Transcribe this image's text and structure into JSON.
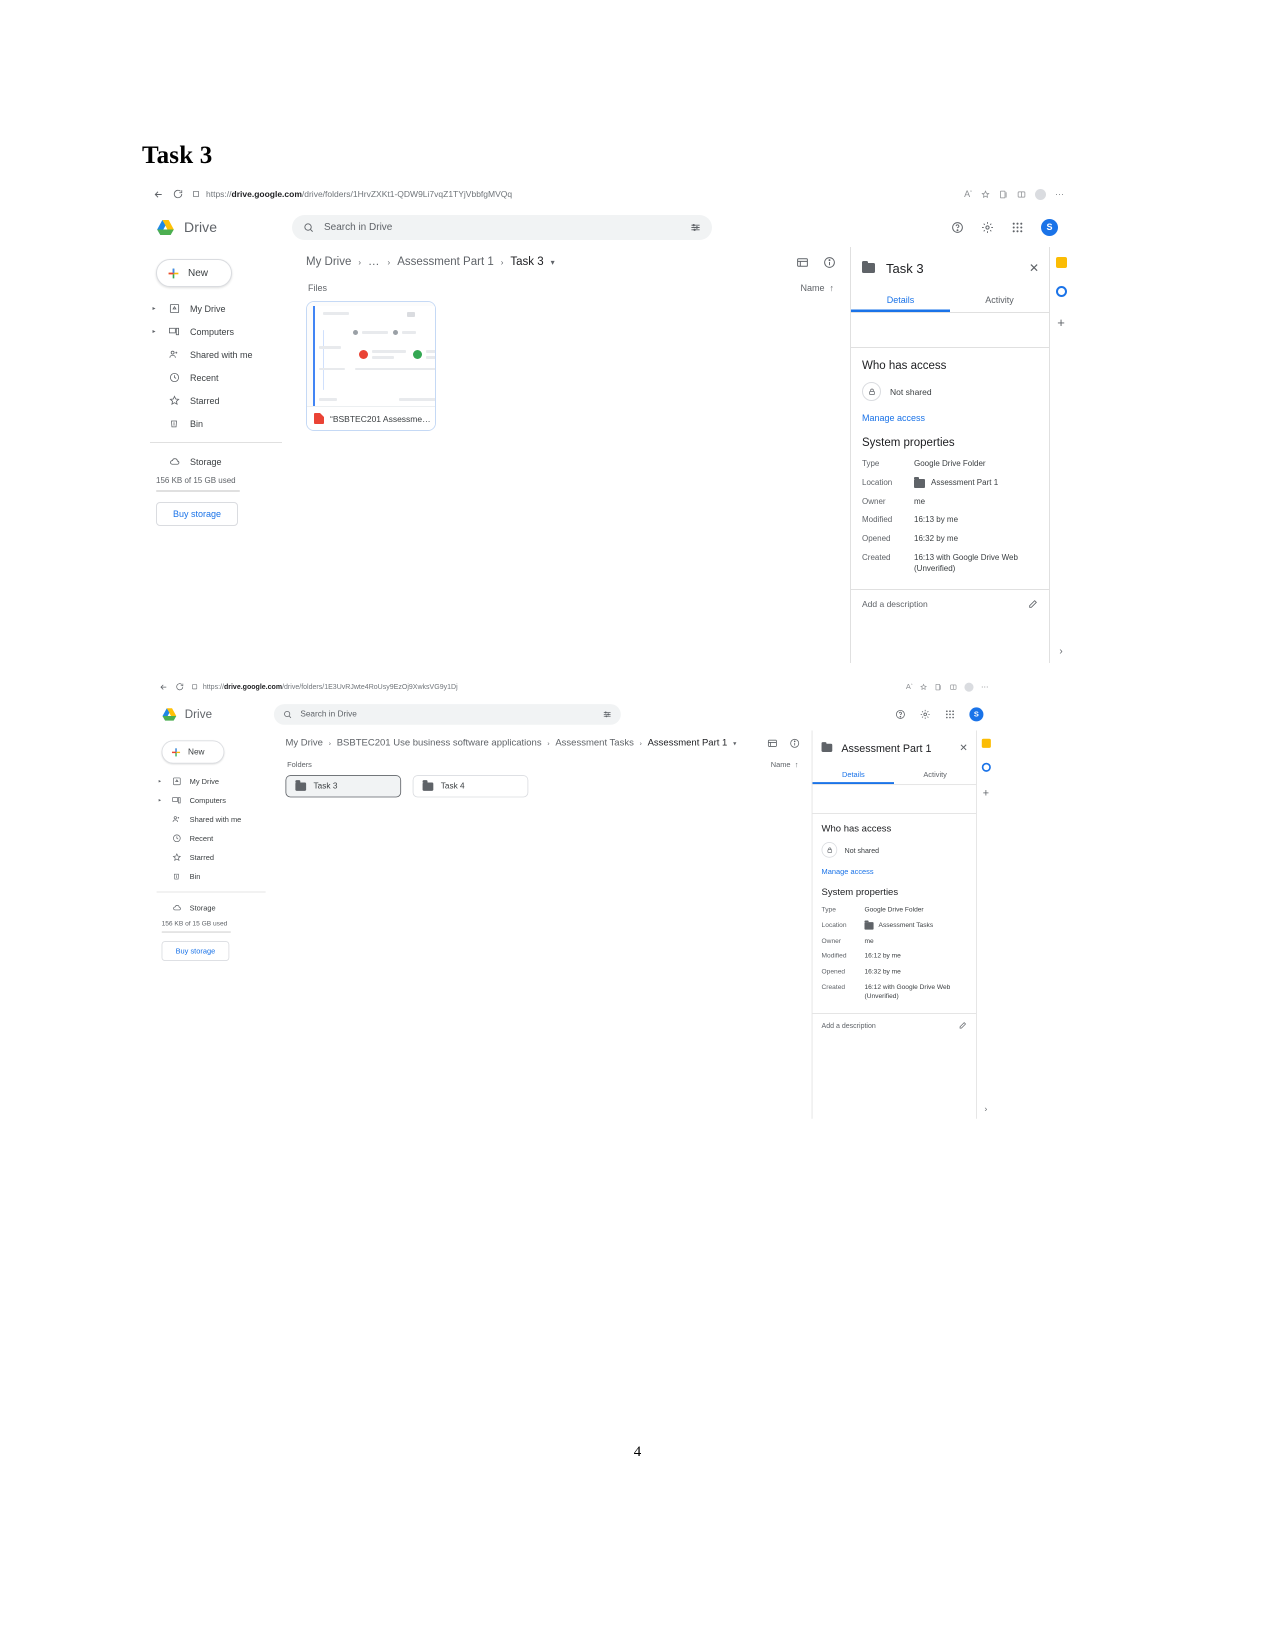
{
  "document": {
    "heading": "Task 3",
    "page_number": "4"
  },
  "screenshot1": {
    "browser": {
      "back_icon": "back-arrow-icon",
      "reload_icon": "reload-icon",
      "site_info_icon": "site-info-icon",
      "url_prefix": "https://",
      "url_domain": "drive.google.com",
      "url_path": "/drive/folders/1HrvZXKt1-QDW9Li7vqZ1TYjVbbfgMVQq",
      "toolbar_icons": [
        "read-aloud-icon",
        "favorites-icon",
        "collections-icon",
        "browser-essentials-icon",
        "profile-icon",
        "settings-more-icon"
      ]
    },
    "header": {
      "app_name": "Drive",
      "search_placeholder": "Search in Drive",
      "search_icon": "search-icon",
      "filter_icon": "search-options-icon",
      "help_icon": "help-icon",
      "settings_icon": "gear-icon",
      "apps_icon": "apps-grid-icon",
      "avatar_initial": "S"
    },
    "sidebar": {
      "new_button": "New",
      "items": [
        {
          "label": "My Drive",
          "icon": "my-drive-icon",
          "expandable": true
        },
        {
          "label": "Computers",
          "icon": "computers-icon",
          "expandable": true
        },
        {
          "label": "Shared with me",
          "icon": "shared-with-me-icon",
          "expandable": false
        },
        {
          "label": "Recent",
          "icon": "clock-icon",
          "expandable": false
        },
        {
          "label": "Starred",
          "icon": "star-icon",
          "expandable": false
        },
        {
          "label": "Bin",
          "icon": "trash-icon",
          "expandable": false
        }
      ],
      "storage_label": "Storage",
      "storage_icon": "cloud-icon",
      "storage_usage": "156 KB of 15 GB used",
      "buy_storage": "Buy storage"
    },
    "breadcrumb": {
      "items": [
        "My Drive",
        "…",
        "Assessment Part 1",
        "Task 3"
      ],
      "chevron": "›",
      "dropdown_icon": "chevron-down-icon",
      "list_view_icon": "list-view-icon",
      "info_icon": "info-icon"
    },
    "content": {
      "section_label": "Files",
      "sort_label": "Name",
      "sort_arrow": "↑",
      "files": [
        {
          "name": "“BSBTEC201 Assessme…",
          "type": "pdf"
        }
      ]
    },
    "details": {
      "title": "Task 3",
      "folder_icon": "folder-icon",
      "close_icon": "close-icon",
      "tabs": [
        {
          "label": "Details",
          "active": true
        },
        {
          "label": "Activity",
          "active": false
        }
      ],
      "access_heading": "Who has access",
      "access_status": "Not shared",
      "lock_icon": "lock-icon",
      "manage_access": "Manage access",
      "properties_heading": "System properties",
      "properties": [
        {
          "key": "Type",
          "value": "Google Drive Folder"
        },
        {
          "key": "Location",
          "value": "Assessment Part 1",
          "has_folder_icon": true
        },
        {
          "key": "Owner",
          "value": "me"
        },
        {
          "key": "Modified",
          "value": "16:13 by me"
        },
        {
          "key": "Opened",
          "value": "16:32 by me"
        },
        {
          "key": "Created",
          "value": "16:13 with Google Drive Web (Unverified)"
        }
      ],
      "add_description": "Add a description",
      "edit_icon": "pencil-icon"
    },
    "rail": {
      "items": [
        "keep-icon",
        "tasks-icon",
        "add-apps-icon"
      ],
      "expand_icon": "›"
    }
  },
  "screenshot2": {
    "browser": {
      "back_icon": "back-arrow-icon",
      "reload_icon": "reload-icon",
      "site_info_icon": "site-info-icon",
      "url_prefix": "https://",
      "url_domain": "drive.google.com",
      "url_path": "/drive/folders/1E3UvRJwte4RoUsy9EzOj9XwksVG9y1Dj",
      "toolbar_icons": [
        "read-aloud-icon",
        "favorites-icon",
        "collections-icon",
        "browser-essentials-icon",
        "profile-icon",
        "settings-more-icon"
      ]
    },
    "header": {
      "app_name": "Drive",
      "search_placeholder": "Search in Drive",
      "search_icon": "search-icon",
      "filter_icon": "search-options-icon",
      "help_icon": "help-icon",
      "settings_icon": "gear-icon",
      "apps_icon": "apps-grid-icon",
      "avatar_initial": "S"
    },
    "sidebar": {
      "new_button": "New",
      "items": [
        {
          "label": "My Drive",
          "icon": "my-drive-icon",
          "expandable": true
        },
        {
          "label": "Computers",
          "icon": "computers-icon",
          "expandable": true
        },
        {
          "label": "Shared with me",
          "icon": "shared-with-me-icon",
          "expandable": false
        },
        {
          "label": "Recent",
          "icon": "clock-icon",
          "expandable": false
        },
        {
          "label": "Starred",
          "icon": "star-icon",
          "expandable": false
        },
        {
          "label": "Bin",
          "icon": "trash-icon",
          "expandable": false
        }
      ],
      "storage_label": "Storage",
      "storage_icon": "cloud-icon",
      "storage_usage": "156 KB of 15 GB used",
      "buy_storage": "Buy storage"
    },
    "breadcrumb": {
      "items": [
        "My Drive",
        "BSBTEC201 Use business software applications",
        "Assessment Tasks",
        "Assessment Part 1"
      ],
      "chevron": "›",
      "dropdown_icon": "chevron-down-icon",
      "list_view_icon": "list-view-icon",
      "info_icon": "info-icon"
    },
    "content": {
      "section_label": "Folders",
      "sort_label": "Name",
      "sort_arrow": "↑",
      "folders": [
        {
          "name": "Task 3",
          "selected": true
        },
        {
          "name": "Task 4",
          "selected": false
        }
      ]
    },
    "details": {
      "title": "Assessment Part 1",
      "folder_icon": "folder-icon",
      "close_icon": "close-icon",
      "tabs": [
        {
          "label": "Details",
          "active": true
        },
        {
          "label": "Activity",
          "active": false
        }
      ],
      "access_heading": "Who has access",
      "access_status": "Not shared",
      "lock_icon": "lock-icon",
      "manage_access": "Manage access",
      "properties_heading": "System properties",
      "properties": [
        {
          "key": "Type",
          "value": "Google Drive Folder"
        },
        {
          "key": "Location",
          "value": "Assessment Tasks",
          "has_folder_icon": true
        },
        {
          "key": "Owner",
          "value": "me"
        },
        {
          "key": "Modified",
          "value": "16:12 by me"
        },
        {
          "key": "Opened",
          "value": "16:32 by me"
        },
        {
          "key": "Created",
          "value": "16:12 with Google Drive Web (Unverified)"
        }
      ],
      "add_description": "Add a description",
      "edit_icon": "pencil-icon"
    },
    "rail": {
      "items": [
        "keep-icon",
        "tasks-icon",
        "add-apps-icon"
      ],
      "expand_icon": "›"
    }
  },
  "colors": {
    "accent": "#1a73e8",
    "pdf": "#ea4335",
    "keep": "#fbbc04",
    "text": "#202124",
    "muted": "#5f6368"
  }
}
